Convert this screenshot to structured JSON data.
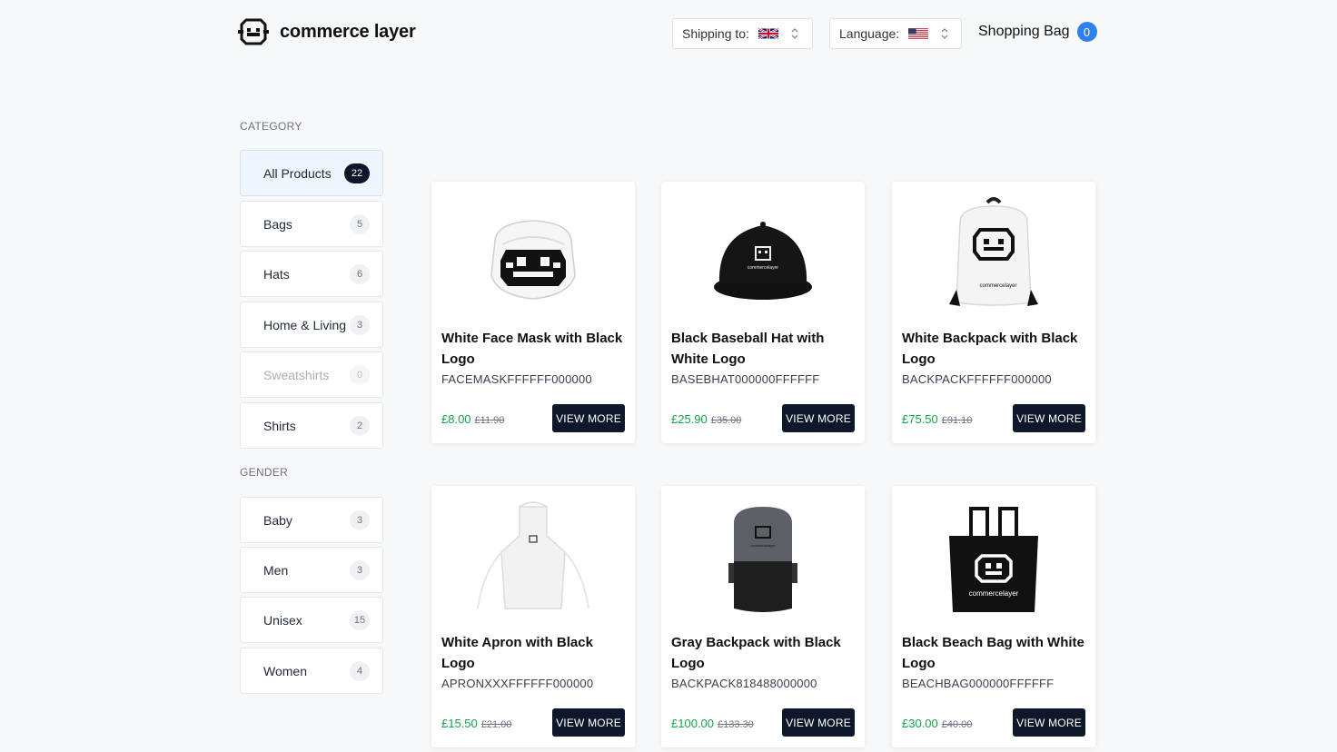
{
  "header": {
    "brand": "commerce layer",
    "shipping_label": "Shipping to:",
    "shipping_flag": "uk-flag-icon",
    "language_label": "Language:",
    "language_flag": "us-flag-icon",
    "bag_label": "Shopping Bag",
    "bag_count": "0"
  },
  "colors": {
    "accent": "#2f80ed",
    "dark": "#0f172a",
    "price": "#16a34a"
  },
  "sidebar": {
    "category_title": "CATEGORY",
    "categories": [
      {
        "label": "All Products",
        "count": "22"
      },
      {
        "label": "Bags",
        "count": "5"
      },
      {
        "label": "Hats",
        "count": "6"
      },
      {
        "label": "Home & Living",
        "count": "3"
      },
      {
        "label": "Sweatshirts",
        "count": "0"
      },
      {
        "label": "Shirts",
        "count": "2"
      }
    ],
    "gender_title": "GENDER",
    "genders": [
      {
        "label": "Baby",
        "count": "3"
      },
      {
        "label": "Men",
        "count": "3"
      },
      {
        "label": "Unisex",
        "count": "15"
      },
      {
        "label": "Women",
        "count": "4"
      }
    ]
  },
  "products": [
    {
      "name": "White Face Mask with Black Logo",
      "sku": "FACEMASKFFFFFF000000",
      "price": "£8.00",
      "old_price": "£11.90",
      "button": "VIEW MORE",
      "image": "face-mask-image"
    },
    {
      "name": "Black Baseball Hat with White Logo",
      "sku": "BASEBHAT000000FFFFFF",
      "price": "£25.90",
      "old_price": "£35.00",
      "button": "VIEW MORE",
      "image": "baseball-hat-image"
    },
    {
      "name": "White Backpack with Black Logo",
      "sku": "BACKPACKFFFFFF000000",
      "price": "£75.50",
      "old_price": "£91.10",
      "button": "VIEW MORE",
      "image": "white-backpack-image"
    },
    {
      "name": "White Apron with Black Logo",
      "sku": "APRONXXXFFFFFF000000",
      "price": "£15.50",
      "old_price": "£21.00",
      "button": "VIEW MORE",
      "image": "apron-image"
    },
    {
      "name": "Gray Backpack with Black Logo",
      "sku": "BACKPACK818488000000",
      "price": "£100.00",
      "old_price": "£133.30",
      "button": "VIEW MORE",
      "image": "gray-backpack-image"
    },
    {
      "name": "Black Beach Bag with White Logo",
      "sku": "BEACHBAG000000FFFFFF",
      "price": "£30.00",
      "old_price": "£40.00",
      "button": "VIEW MORE",
      "image": "beach-bag-image"
    }
  ],
  "product_logo_text": "commercelayer"
}
